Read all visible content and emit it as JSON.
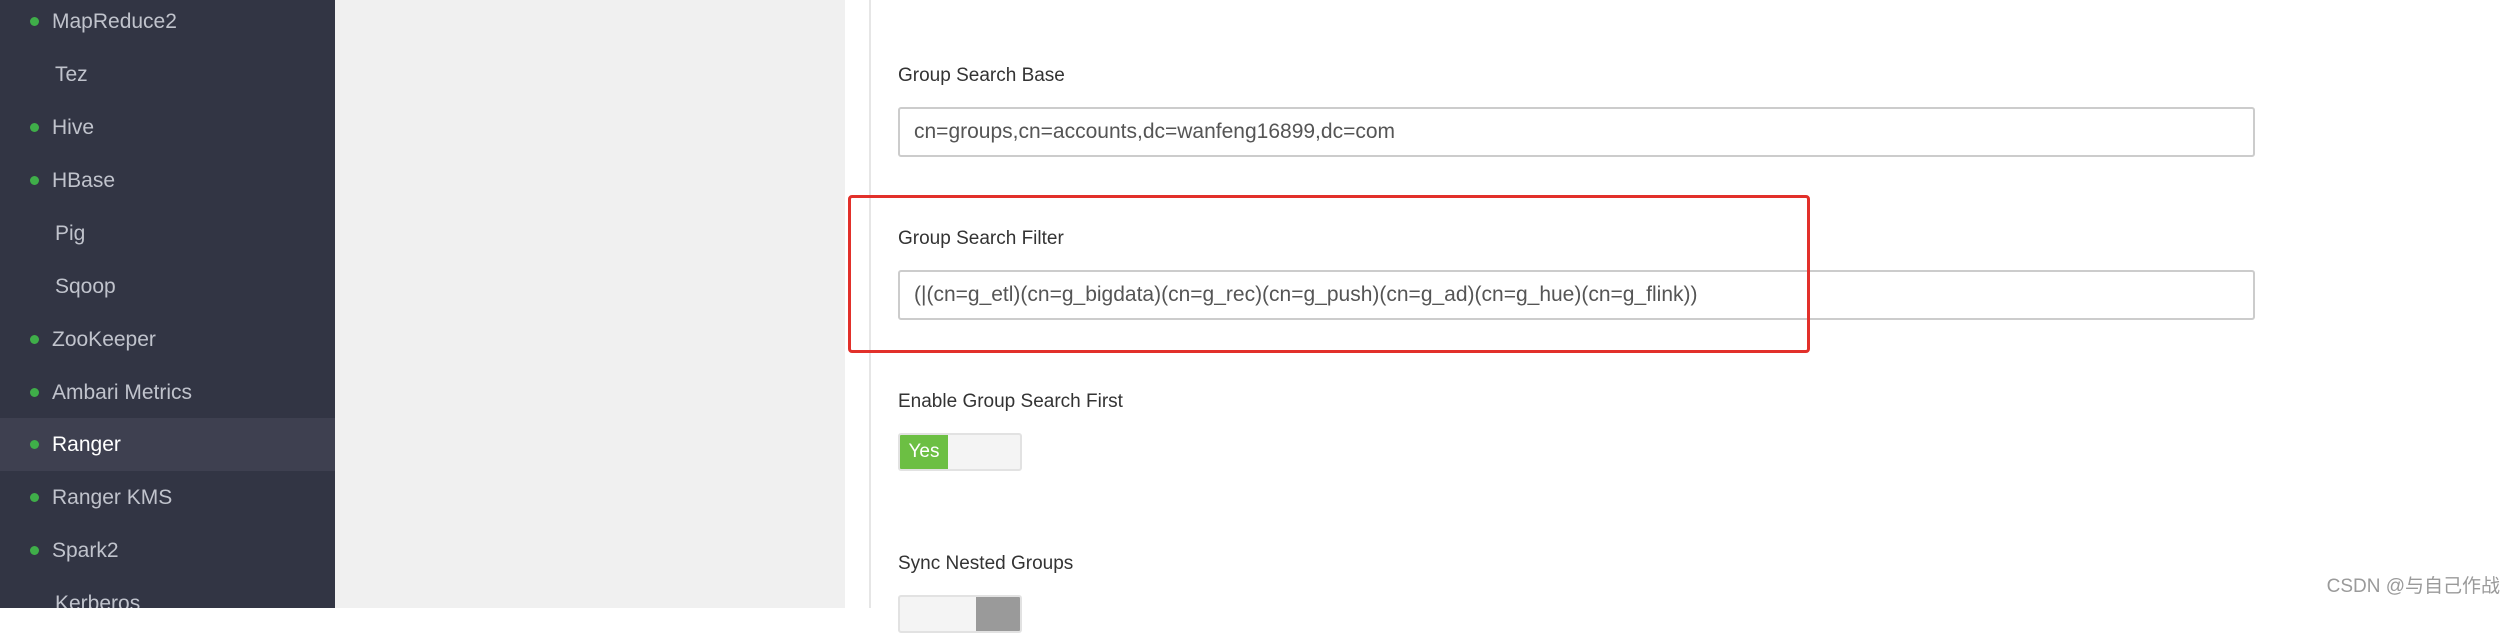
{
  "sidebar": {
    "items": [
      {
        "label": "MapReduce2",
        "status": true,
        "active": false
      },
      {
        "label": "Tez",
        "status": false,
        "active": false
      },
      {
        "label": "Hive",
        "status": true,
        "active": false
      },
      {
        "label": "HBase",
        "status": true,
        "active": false
      },
      {
        "label": "Pig",
        "status": false,
        "active": false
      },
      {
        "label": "Sqoop",
        "status": false,
        "active": false
      },
      {
        "label": "ZooKeeper",
        "status": true,
        "active": false
      },
      {
        "label": "Ambari Metrics",
        "status": true,
        "active": false
      },
      {
        "label": "Ranger",
        "status": true,
        "active": true
      },
      {
        "label": "Ranger KMS",
        "status": true,
        "active": false
      },
      {
        "label": "Spark2",
        "status": true,
        "active": false
      },
      {
        "label": "Kerberos",
        "status": false,
        "active": false
      }
    ],
    "status_dot_color": "#3fae49"
  },
  "form": {
    "group_search_base": {
      "label": "Group Search Base",
      "value": "cn=groups,cn=accounts,dc=wanfeng16899,dc=com"
    },
    "group_search_filter": {
      "label": "Group Search Filter",
      "value": "(|(cn=g_etl)(cn=g_bigdata)(cn=g_rec)(cn=g_push)(cn=g_ad)(cn=g_hue)(cn=g_flink))"
    },
    "enable_group_search_first": {
      "label": "Enable Group Search First",
      "toggle_label": "Yes",
      "enabled": true
    },
    "sync_nested_groups": {
      "label": "Sync Nested Groups",
      "enabled": false
    }
  },
  "highlight_color": "#e2302a",
  "watermark": "CSDN @与自己作战"
}
